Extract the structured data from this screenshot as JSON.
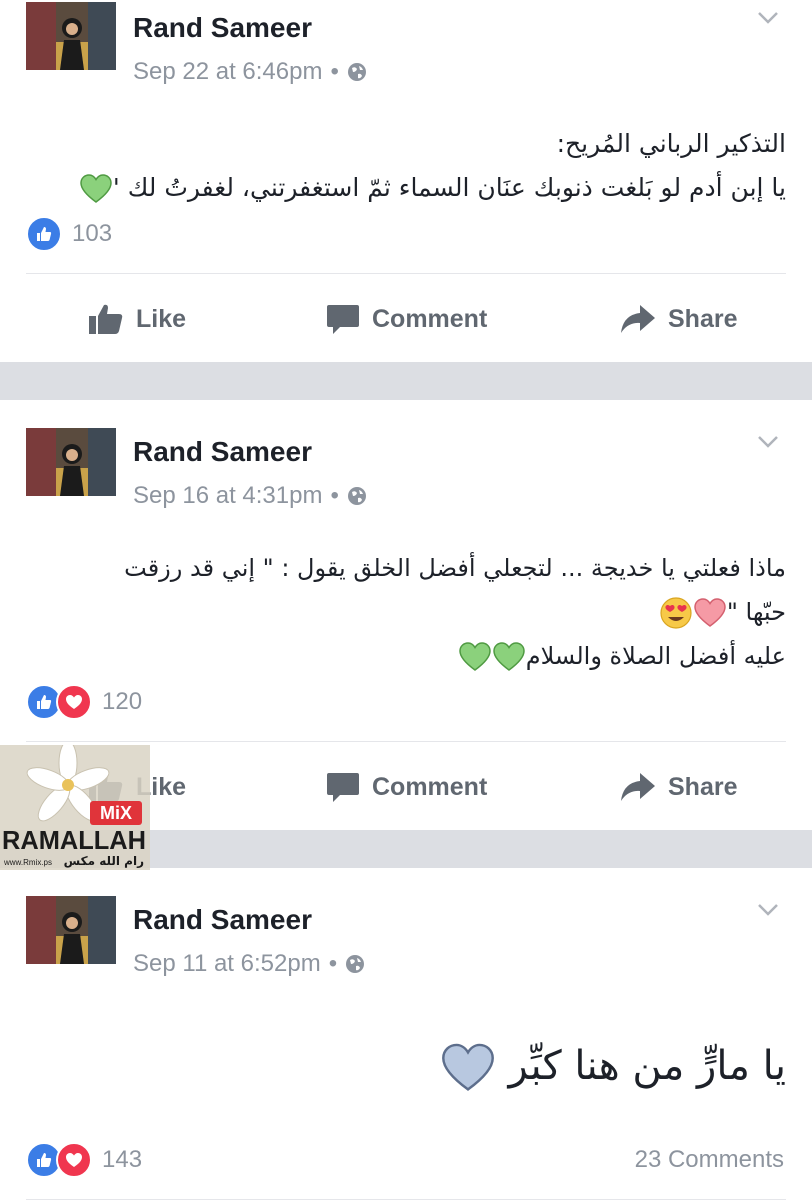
{
  "posts": [
    {
      "author": "Rand Sameer",
      "timestamp": "Sep 22 at 6:46pm",
      "separator": "•",
      "lines": [
        "التذكير الرباني المُريح:",
        "يا إبن أدم لو بَلغت ذنوبك عنَان السماء ثمّ استغفرتني، لغفرتُ لك '"
      ],
      "reaction_count": "103",
      "reactions": [
        "like"
      ]
    },
    {
      "author": "Rand Sameer",
      "timestamp": "Sep 16 at 4:31pm",
      "separator": "•",
      "lines": [
        "ماذا فعلتي يا خديجة ... لتجعلي أفضل الخلق يقول : \" إني قد رزقت",
        "حبّها \"",
        "عليه أفضل الصلاة والسلام"
      ],
      "reaction_count": "120",
      "reactions": [
        "like",
        "love"
      ]
    },
    {
      "author": "Rand Sameer",
      "timestamp": "Sep 11 at 6:52pm",
      "separator": "•",
      "lines": [
        "يا مارٍّ من هنا كبِّر"
      ],
      "reaction_count": "143",
      "comments_count": "23 Comments",
      "reactions": [
        "like",
        "love"
      ]
    }
  ],
  "actions": {
    "like": "Like",
    "comment": "Comment",
    "share": "Share"
  },
  "watermark": {
    "brand": "RAMALLAH",
    "mix": "MiX",
    "arabic": "رام الله مكس",
    "url": "www.Rmix.ps"
  },
  "colors": {
    "like_blue": "#3b7de6",
    "love_red": "#f0364f",
    "green_heart": "#8bd17c",
    "pink_heart": "#f59aa5",
    "blue_heart": "#b8c8e0"
  }
}
